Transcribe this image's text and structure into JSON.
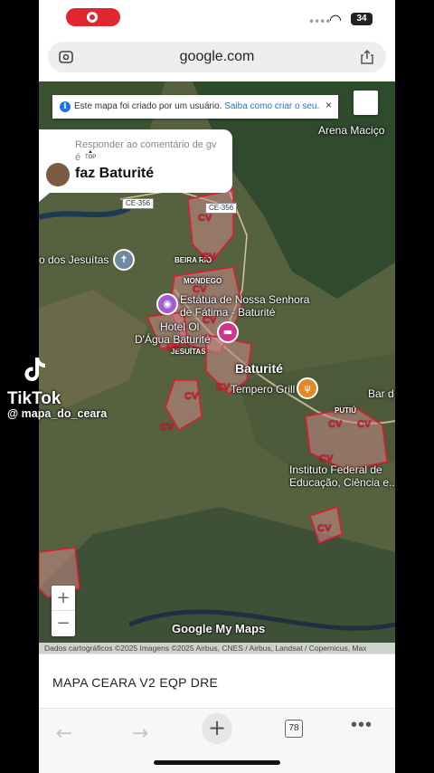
{
  "status_bar": {
    "battery": "34"
  },
  "browser": {
    "url": "google.com",
    "tabs_count": "78"
  },
  "map": {
    "notice_text": "Este mapa foi criado por um usuário.",
    "notice_link": "Saiba como criar o seu.",
    "labels": {
      "arena": "Arena Maciço",
      "jesuitas": "o dos Jesuítas",
      "beira_rio": "BEIRA RIO",
      "mondego": "MONDEGO",
      "estatua_1": "Estátua de Nossa Senhora",
      "estatua_2": "de Fátima - Baturité",
      "hotel_1": "Hotel Ol",
      "hotel_2": "D'Água Baturité",
      "jesuitas_small": "JESUÍTAS",
      "baturite": "Baturité",
      "tempero": "Tempero Grill",
      "bar": "Bar d",
      "putiu": "PUTIÚ",
      "instituto_1": "Instituto Federal de",
      "instituto_2": "Educação, Ciência e..."
    },
    "road_shields": [
      "CE-356",
      "CE-356"
    ],
    "cv_label": "CV",
    "logo": "Google My Maps",
    "attribution": "Dados cartográficos ©2025 Imagens ©2025 Airbus, CNES / Airbus, Landsat / Copernicus, Max",
    "zoom_in": "+",
    "zoom_out": "−"
  },
  "comment": {
    "reply_text": "Responder ao comentário de gv",
    "suffix": "é",
    "top_badge": "TOP",
    "text": "faz Baturité"
  },
  "tiktok": {
    "name": "TikTok",
    "handle": "@ mapa_do_ceara"
  },
  "page": {
    "map_title": "MAPA CEARA V2 EQP DRE"
  },
  "toolbar": {
    "back": "←",
    "forward": "→",
    "new_tab": "+",
    "more": "•••"
  },
  "colors": {
    "accent": "#1a73e8",
    "cv_red": "#e8162c",
    "record": "#e0262f"
  }
}
